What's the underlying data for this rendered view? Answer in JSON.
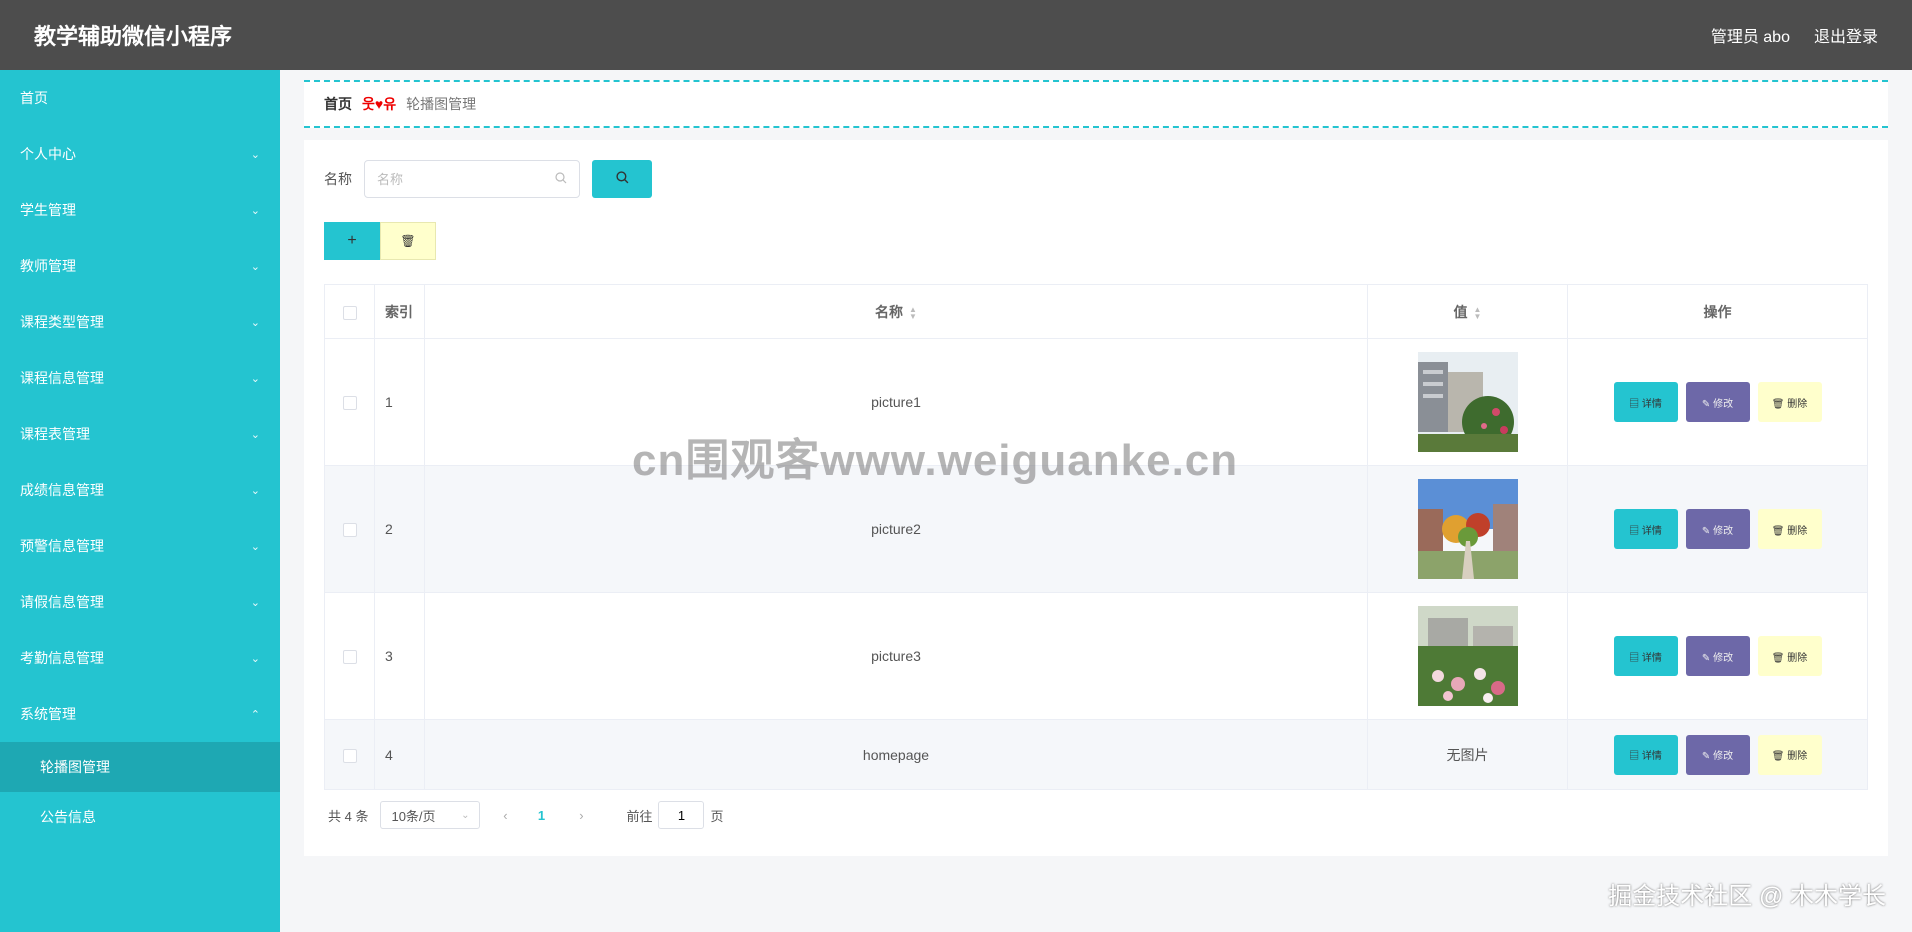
{
  "header": {
    "title": "教学辅助微信小程序",
    "user": "管理员 abo",
    "logout": "退出登录"
  },
  "sidebar": {
    "items": [
      {
        "label": "首页",
        "chevron": ""
      },
      {
        "label": "个人中心",
        "chevron": "⌄"
      },
      {
        "label": "学生管理",
        "chevron": "⌄"
      },
      {
        "label": "教师管理",
        "chevron": "⌄"
      },
      {
        "label": "课程类型管理",
        "chevron": "⌄"
      },
      {
        "label": "课程信息管理",
        "chevron": "⌄"
      },
      {
        "label": "课程表管理",
        "chevron": "⌄"
      },
      {
        "label": "成绩信息管理",
        "chevron": "⌄"
      },
      {
        "label": "预警信息管理",
        "chevron": "⌄"
      },
      {
        "label": "请假信息管理",
        "chevron": "⌄"
      },
      {
        "label": "考勤信息管理",
        "chevron": "⌄"
      },
      {
        "label": "系统管理",
        "chevron": "⌃"
      }
    ],
    "subitems": [
      "轮播图管理",
      "公告信息"
    ]
  },
  "breadcrumb": {
    "home": "首页",
    "separator": "웃♥유",
    "current": "轮播图管理"
  },
  "search": {
    "label": "名称",
    "placeholder": "名称",
    "search_icon": "search-icon"
  },
  "toolbar": {
    "add_label": "+",
    "delete_label": "🗑"
  },
  "table": {
    "headers": {
      "index": "索引",
      "name": "名称",
      "value": "值",
      "ops": "操作"
    },
    "rows": [
      {
        "index": "1",
        "name": "picture1",
        "value": "image"
      },
      {
        "index": "2",
        "name": "picture2",
        "value": "image"
      },
      {
        "index": "3",
        "name": "picture3",
        "value": "image"
      },
      {
        "index": "4",
        "name": "homepage",
        "value": "无图片"
      }
    ],
    "ops": {
      "detail": "▤ 详情",
      "edit": "✎ 修改",
      "delete": "🗑 删除"
    }
  },
  "pagination": {
    "total": "共 4 条",
    "page_size": "10条/页",
    "prev": "‹",
    "current_page": "1",
    "next": "›",
    "goto_label": "前往",
    "goto_value": "1",
    "page_unit": "页"
  },
  "watermark": "cn围观客www.weiguanke.cn",
  "footer_watermark": "掘金技术社区 @ 木木学长",
  "colors": {
    "accent": "#24c4d0",
    "header": "#4d4d4d",
    "edit": "#6d68a8",
    "delete": "#ffffcc"
  }
}
